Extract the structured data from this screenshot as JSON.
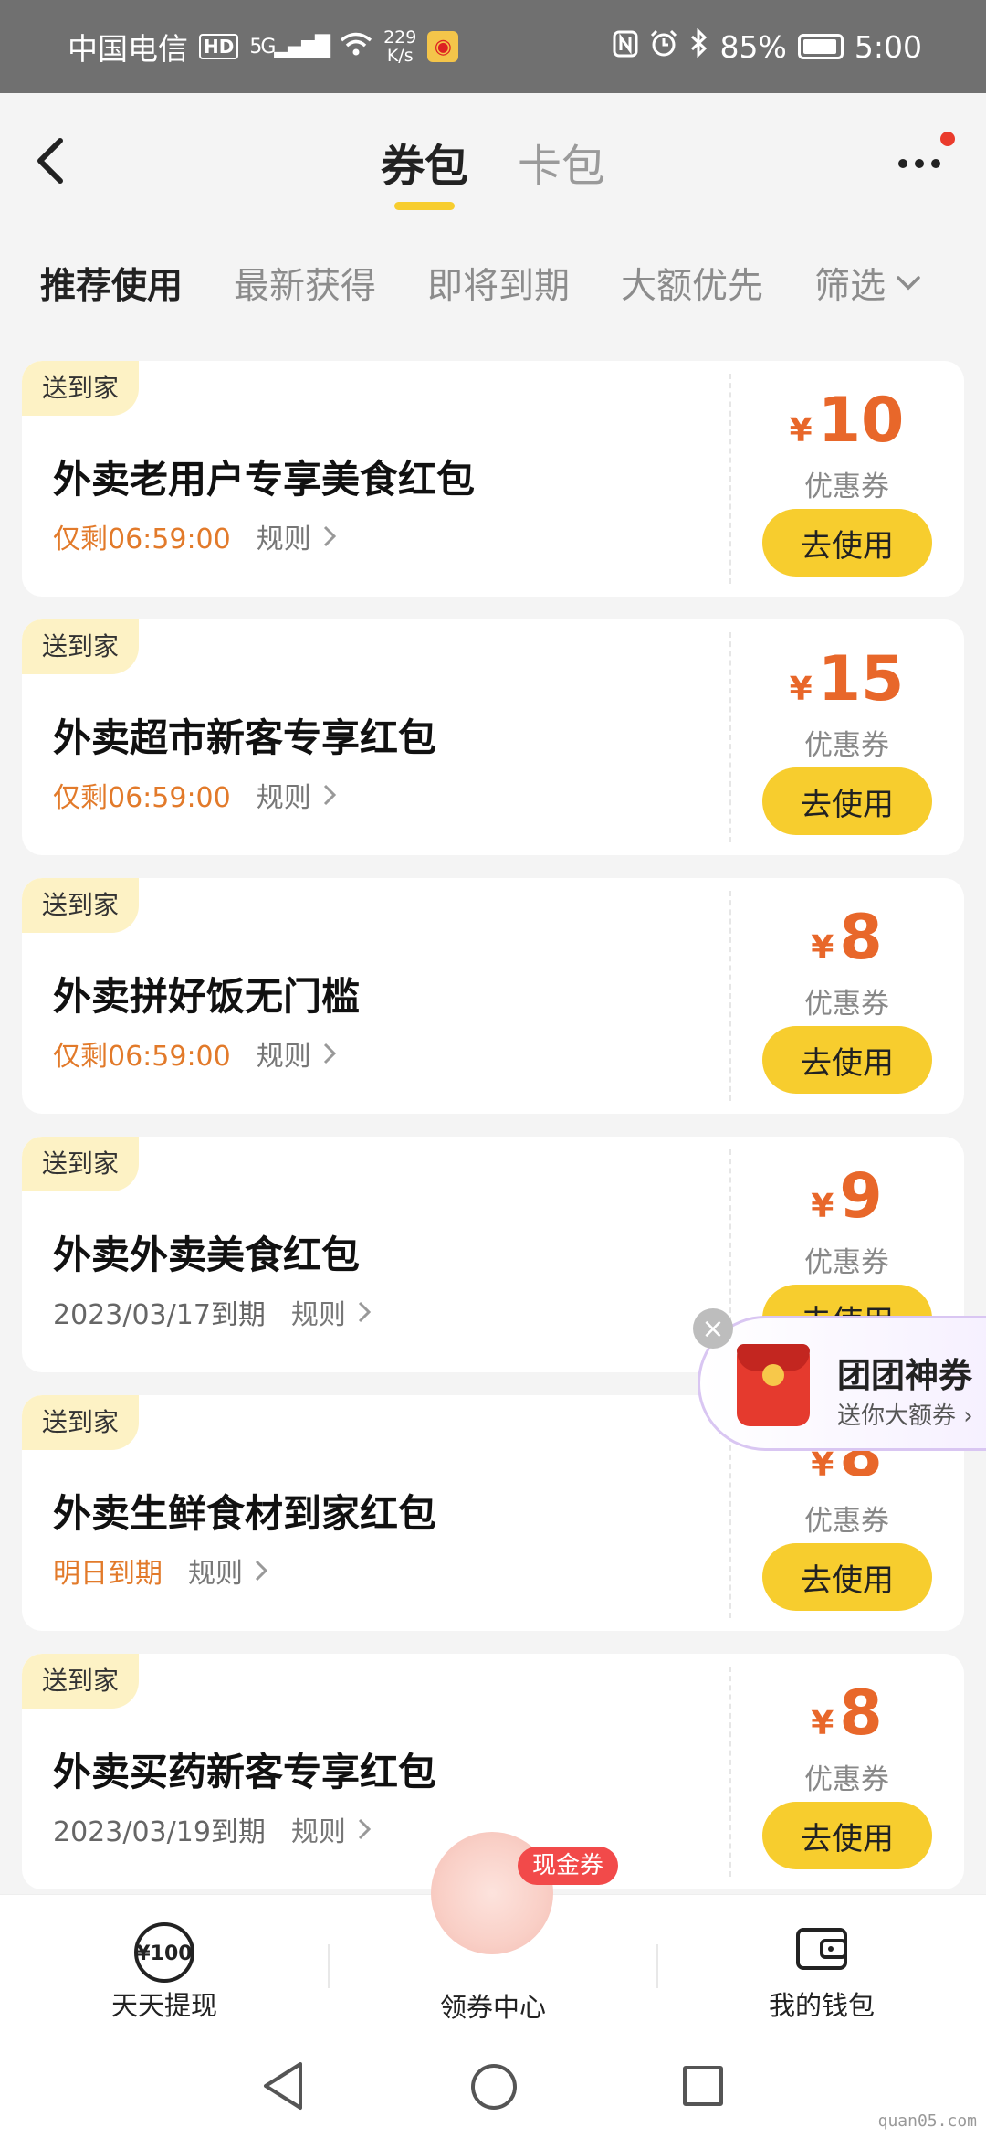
{
  "status_bar": {
    "carrier": "中国电信",
    "hd": "HD",
    "network": "5G",
    "speed_value": "229",
    "speed_unit": "K/s",
    "battery": "85%",
    "time": "5:00"
  },
  "header": {
    "tabs": [
      {
        "label": "券包",
        "active": true
      },
      {
        "label": "卡包",
        "active": false
      }
    ]
  },
  "sort_tabs": [
    {
      "label": "推荐使用",
      "active": true
    },
    {
      "label": "最新获得",
      "active": false
    },
    {
      "label": "即将到期",
      "active": false
    },
    {
      "label": "大额优先",
      "active": false
    }
  ],
  "filter_label": "筛选",
  "coupons": [
    {
      "tag": "送到家",
      "title": "外卖老用户专享美食红包",
      "expiry": "仅剩06:59:00",
      "expiry_style": "orange",
      "rule": "规则",
      "currency": "¥",
      "amount": "10",
      "type": "优惠券",
      "button": "去使用"
    },
    {
      "tag": "送到家",
      "title": "外卖超市新客专享红包",
      "expiry": "仅剩06:59:00",
      "expiry_style": "orange",
      "rule": "规则",
      "currency": "¥",
      "amount": "15",
      "type": "优惠券",
      "button": "去使用"
    },
    {
      "tag": "送到家",
      "title": "外卖拼好饭无门槛",
      "expiry": "仅剩06:59:00",
      "expiry_style": "orange",
      "rule": "规则",
      "currency": "¥",
      "amount": "8",
      "type": "优惠券",
      "button": "去使用"
    },
    {
      "tag": "送到家",
      "title": "外卖外卖美食红包",
      "expiry": "2023/03/17到期",
      "expiry_style": "gray",
      "rule": "规则",
      "currency": "¥",
      "amount": "9",
      "type": "优惠券",
      "button": "去使用"
    },
    {
      "tag": "送到家",
      "title": "外卖生鲜食材到家红包",
      "expiry": "明日到期",
      "expiry_style": "orange",
      "rule": "规则",
      "currency": "¥",
      "amount": "8",
      "type": "优惠券",
      "button": "去使用"
    },
    {
      "tag": "送到家",
      "title": "外卖买药新客专享红包",
      "expiry": "2023/03/19到期",
      "expiry_style": "gray",
      "rule": "规则",
      "currency": "¥",
      "amount": "8",
      "type": "优惠券",
      "button": "去使用"
    }
  ],
  "promo": {
    "title": "团团神券",
    "subtitle": "送你大额券"
  },
  "bottom_nav": {
    "left": {
      "label": "天天提现",
      "icon_text": "¥100"
    },
    "center": {
      "label": "领券中心",
      "badge": "现金券"
    },
    "right": {
      "label": "我的钱包"
    }
  },
  "watermark": "quan05.com"
}
